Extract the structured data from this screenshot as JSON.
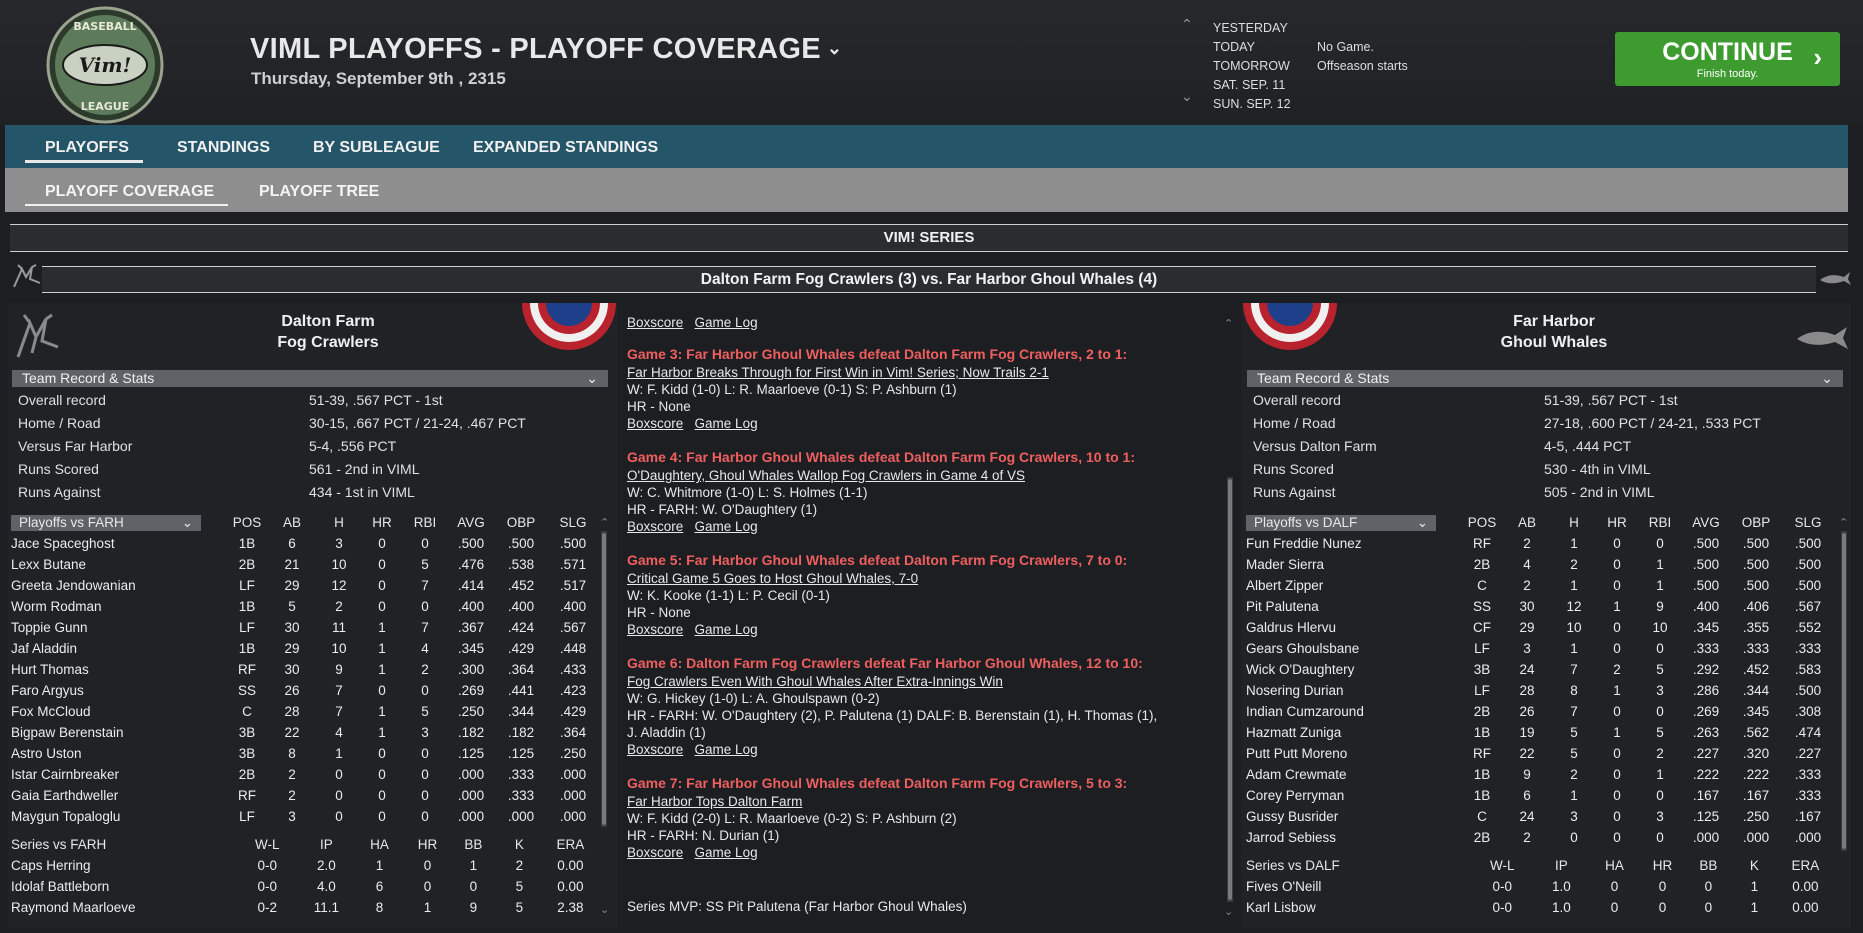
{
  "header": {
    "title": "VIML PLAYOFFS - PLAYOFF COVERAGE",
    "date": "Thursday, September 9th , 2315",
    "logo_top": "BASEBALL",
    "logo_mid": "Vim!",
    "logo_bottom": "LEAGUE"
  },
  "schedule": [
    {
      "label": "YESTERDAY",
      "value": ""
    },
    {
      "label": "TODAY",
      "value": "No Game."
    },
    {
      "label": "TOMORROW",
      "value": "Offseason starts"
    },
    {
      "label": "SAT. SEP. 11",
      "value": ""
    },
    {
      "label": "SUN. SEP. 12",
      "value": ""
    }
  ],
  "continue": {
    "label": "CONTINUE",
    "sub": "Finish today."
  },
  "nav": {
    "playoffs": "PLAYOFFS",
    "standings": "STANDINGS",
    "by_subleague": "BY SUBLEAGUE",
    "expanded": "EXPANDED STANDINGS"
  },
  "subnav": {
    "coverage": "PLAYOFF COVERAGE",
    "tree": "PLAYOFF TREE"
  },
  "series_title": "VIM! SERIES",
  "matchup": "Dalton Farm Fog Crawlers (3) vs. Far Harbor Ghoul Whales (4)",
  "left": {
    "name1": "Dalton Farm",
    "name2": "Fog Crawlers",
    "record_header": "Team Record & Stats",
    "stats": [
      {
        "k": "Overall record",
        "v": "51-39, .567 PCT - 1st"
      },
      {
        "k": "Home / Road",
        "v": "30-15, .667 PCT / 21-24, .467 PCT"
      },
      {
        "k": "Versus Far Harbor",
        "v": "5-4, .556 PCT"
      },
      {
        "k": "Runs Scored",
        "v": "561 - 2nd in VIML"
      },
      {
        "k": "Runs Against",
        "v": "434 - 1st in VIML"
      }
    ],
    "bat_select": "Playoffs vs FARH",
    "bat_cols": [
      "POS",
      "AB",
      "H",
      "HR",
      "RBI",
      "AVG",
      "OBP",
      "SLG"
    ],
    "batters": [
      [
        "Jace Spaceghost",
        "1B",
        "6",
        "3",
        "0",
        "0",
        ".500",
        ".500",
        ".500"
      ],
      [
        "Lexx Butane",
        "2B",
        "21",
        "10",
        "0",
        "5",
        ".476",
        ".538",
        ".571"
      ],
      [
        "Greeta Jendowanian",
        "LF",
        "29",
        "12",
        "0",
        "7",
        ".414",
        ".452",
        ".517"
      ],
      [
        "Worm Rodman",
        "1B",
        "5",
        "2",
        "0",
        "0",
        ".400",
        ".400",
        ".400"
      ],
      [
        "Toppie Gunn",
        "LF",
        "30",
        "11",
        "1",
        "7",
        ".367",
        ".424",
        ".567"
      ],
      [
        "Jaf Aladdin",
        "1B",
        "29",
        "10",
        "1",
        "4",
        ".345",
        ".429",
        ".448"
      ],
      [
        "Hurt Thomas",
        "RF",
        "30",
        "9",
        "1",
        "2",
        ".300",
        ".364",
        ".433"
      ],
      [
        "Faro Argyus",
        "SS",
        "26",
        "7",
        "0",
        "0",
        ".269",
        ".441",
        ".423"
      ],
      [
        "Fox McCloud",
        "C",
        "28",
        "7",
        "1",
        "5",
        ".250",
        ".344",
        ".429"
      ],
      [
        "Bigpaw Berenstain",
        "3B",
        "22",
        "4",
        "1",
        "3",
        ".182",
        ".182",
        ".364"
      ],
      [
        "Astro Uston",
        "3B",
        "8",
        "1",
        "0",
        "0",
        ".125",
        ".125",
        ".250"
      ],
      [
        "Istar Cairnbreaker",
        "2B",
        "2",
        "0",
        "0",
        "0",
        ".000",
        ".333",
        ".000"
      ],
      [
        "Gaia Earthdweller",
        "RF",
        "2",
        "0",
        "0",
        "0",
        ".000",
        ".333",
        ".000"
      ],
      [
        "Maygun Topaloglu",
        "LF",
        "3",
        "0",
        "0",
        "0",
        ".000",
        ".000",
        ".000"
      ]
    ],
    "pit_header": "Series vs FARH",
    "pit_cols": [
      "W-L",
      "IP",
      "HA",
      "HR",
      "BB",
      "K",
      "ERA"
    ],
    "pitchers": [
      [
        "Caps Herring",
        "0-0",
        "2.0",
        "1",
        "0",
        "1",
        "2",
        "0.00"
      ],
      [
        "Idolaf Battleborn",
        "0-0",
        "4.0",
        "6",
        "0",
        "0",
        "5",
        "0.00"
      ],
      [
        "Raymond Maarloeve",
        "0-2",
        "11.1",
        "8",
        "1",
        "9",
        "5",
        "2.38"
      ]
    ]
  },
  "right": {
    "name1": "Far Harbor",
    "name2": "Ghoul Whales",
    "record_header": "Team Record & Stats",
    "stats": [
      {
        "k": "Overall record",
        "v": "51-39, .567 PCT - 1st"
      },
      {
        "k": "Home / Road",
        "v": "27-18, .600 PCT / 24-21, .533 PCT"
      },
      {
        "k": "Versus Dalton Farm",
        "v": "4-5, .444 PCT"
      },
      {
        "k": "Runs Scored",
        "v": "530 - 4th in VIML"
      },
      {
        "k": "Runs Against",
        "v": "505 - 2nd in VIML"
      }
    ],
    "bat_select": "Playoffs vs DALF",
    "bat_cols": [
      "POS",
      "AB",
      "H",
      "HR",
      "RBI",
      "AVG",
      "OBP",
      "SLG"
    ],
    "batters": [
      [
        "Fun Freddie Nunez",
        "RF",
        "2",
        "1",
        "0",
        "0",
        ".500",
        ".500",
        ".500"
      ],
      [
        "Mader Sierra",
        "2B",
        "4",
        "2",
        "0",
        "1",
        ".500",
        ".500",
        ".500"
      ],
      [
        "Albert Zipper",
        "C",
        "2",
        "1",
        "0",
        "1",
        ".500",
        ".500",
        ".500"
      ],
      [
        "Pit Palutena",
        "SS",
        "30",
        "12",
        "1",
        "9",
        ".400",
        ".406",
        ".567"
      ],
      [
        "Galdrus Hlervu",
        "CF",
        "29",
        "10",
        "0",
        "10",
        ".345",
        ".355",
        ".552"
      ],
      [
        "Gears Ghoulsbane",
        "LF",
        "3",
        "1",
        "0",
        "0",
        ".333",
        ".333",
        ".333"
      ],
      [
        "Wick O'Daughtery",
        "3B",
        "24",
        "7",
        "2",
        "5",
        ".292",
        ".452",
        ".583"
      ],
      [
        "Nosering Durian",
        "LF",
        "28",
        "8",
        "1",
        "3",
        ".286",
        ".344",
        ".500"
      ],
      [
        "Indian Cumzaround",
        "2B",
        "26",
        "7",
        "0",
        "0",
        ".269",
        ".345",
        ".308"
      ],
      [
        "Hazmatt Zuniga",
        "1B",
        "19",
        "5",
        "1",
        "5",
        ".263",
        ".562",
        ".474"
      ],
      [
        "Putt Putt Moreno",
        "RF",
        "22",
        "5",
        "0",
        "2",
        ".227",
        ".320",
        ".227"
      ],
      [
        "Adam Crewmate",
        "1B",
        "9",
        "2",
        "0",
        "1",
        ".222",
        ".222",
        ".333"
      ],
      [
        "Corey Perryman",
        "1B",
        "6",
        "1",
        "0",
        "0",
        ".167",
        ".167",
        ".333"
      ],
      [
        "Gussy Busrider",
        "C",
        "24",
        "3",
        "0",
        "3",
        ".125",
        ".250",
        ".167"
      ],
      [
        "Jarrod Sebiess",
        "2B",
        "2",
        "0",
        "0",
        "0",
        ".000",
        ".000",
        ".000"
      ]
    ],
    "pit_header": "Series vs DALF",
    "pit_cols": [
      "W-L",
      "IP",
      "HA",
      "HR",
      "BB",
      "K",
      "ERA"
    ],
    "pitchers": [
      [
        "Fives O'Neill",
        "0-0",
        "1.0",
        "0",
        "0",
        "0",
        "1",
        "0.00"
      ],
      [
        "Karl Lisbow",
        "0-0",
        "1.0",
        "0",
        "0",
        "0",
        "1",
        "0.00"
      ]
    ]
  },
  "links": {
    "boxscore": "Boxscore",
    "gamelog": "Game Log"
  },
  "games": [
    {
      "title": "Game 3: Far Harbor Ghoul Whales defeat Dalton Farm Fog Crawlers, 2 to 1:",
      "headline": "Far Harbor Breaks Through for First Win in Vim! Series; Now Trails 2-1",
      "line1": "W: F. Kidd (1-0) L: R. Maarloeve (0-1) S: P. Ashburn (1)",
      "line2": "HR - None",
      "line3": ""
    },
    {
      "title": "Game 4: Far Harbor Ghoul Whales defeat Dalton Farm Fog Crawlers, 10 to 1:",
      "headline": "O'Daughtery, Ghoul Whales Wallop Fog Crawlers in Game 4 of VS",
      "line1": "W: C. Whitmore (1-0) L: S. Holmes (1-1)",
      "line2": "HR - FARH: W. O'Daughtery (1)",
      "line3": ""
    },
    {
      "title": "Game 5: Far Harbor Ghoul Whales defeat Dalton Farm Fog Crawlers, 7 to 0:",
      "headline": "Critical Game 5 Goes to Host Ghoul Whales, 7-0",
      "line1": "W: K. Kooke (1-1) L: P. Cecil (0-1)",
      "line2": "HR - None",
      "line3": ""
    },
    {
      "title": "Game 6: Dalton Farm Fog Crawlers defeat Far Harbor Ghoul Whales, 12 to 10:",
      "headline": "Fog Crawlers Even With Ghoul Whales After Extra-Innings Win",
      "line1": "W: G. Hickey (1-0) L: A. Ghoulspawn (0-2)",
      "line2": "HR - FARH: W. O'Daughtery (2), P. Palutena (1)  DALF: B. Berenstain (1), H. Thomas (1),",
      "line3": "J. Aladdin (1)"
    },
    {
      "title": "Game 7: Far Harbor Ghoul Whales defeat Dalton Farm Fog Crawlers, 5 to 3:",
      "headline": "Far Harbor Tops Dalton Farm",
      "line1": "W: F. Kidd (2-0) L: R. Maarloeve (0-2) S: P. Ashburn (2)",
      "line2": "HR - FARH: N. Durian (1)",
      "line3": ""
    }
  ],
  "mvp": "Series MVP: SS Pit Palutena (Far Harbor Ghoul Whales)",
  "colors": {
    "nav": "#245569",
    "continue": "#3d9b2f",
    "game_title": "#ef5f5f"
  }
}
